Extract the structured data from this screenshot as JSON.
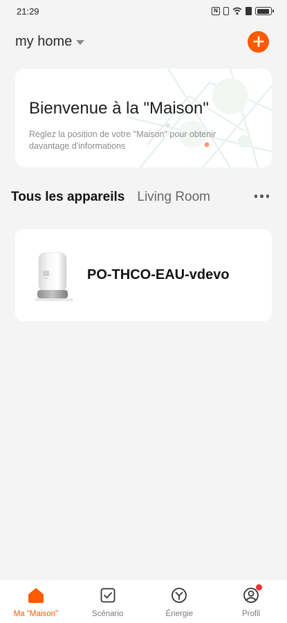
{
  "status_bar": {
    "time": "21:29",
    "battery_level": 0.9
  },
  "header": {
    "home_name": "my home",
    "icons": {
      "dropdown": "caret-down-icon",
      "add": "plus-icon"
    },
    "accent_color": "#ff5a00"
  },
  "welcome": {
    "title": "Bienvenue à la \"Maison\"",
    "subtitle": "Reglez la position de votre \"Maison\" pour obtenir davantage d'informations"
  },
  "tabs": [
    {
      "label": "Tous les appareils",
      "active": true
    },
    {
      "label": "Living Room",
      "active": false
    }
  ],
  "devices": [
    {
      "name": "PO-THCO-EAU-vdevo",
      "icon": "thermostat-valve-icon"
    }
  ],
  "bottom_nav": [
    {
      "label": "Ma \"Maison\"",
      "icon": "home-icon",
      "active": true
    },
    {
      "label": "Scénario",
      "icon": "scenario-checkbox-icon",
      "active": false
    },
    {
      "label": "Énergie",
      "icon": "energy-icon",
      "active": false
    },
    {
      "label": "Profil",
      "icon": "profile-icon",
      "active": false,
      "badge": true
    }
  ]
}
